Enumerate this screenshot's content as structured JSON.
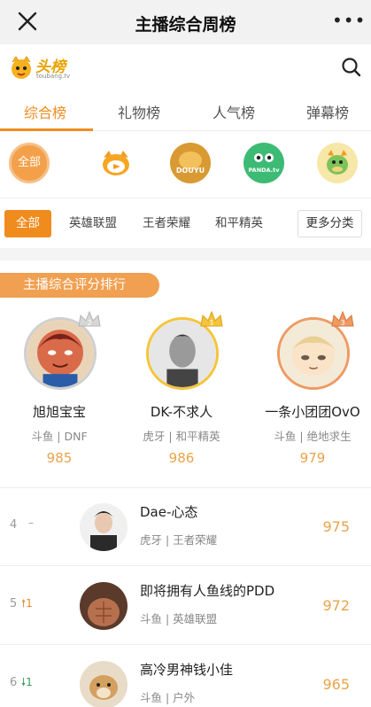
{
  "header": {
    "title": "主播综合周榜",
    "close_icon": "close-icon",
    "more_label": "•••"
  },
  "brand": {
    "name": "头榜",
    "sub": "toubang.tv"
  },
  "tabs": [
    {
      "label": "综合榜",
      "active": true
    },
    {
      "label": "礼物榜"
    },
    {
      "label": "人气榜"
    },
    {
      "label": "弹幕榜"
    }
  ],
  "platforms": [
    {
      "label": "全部",
      "active": true
    },
    {
      "label": "",
      "icon": "huya-logo-icon"
    },
    {
      "label": "DOUYU",
      "icon": "douyu-logo-icon"
    },
    {
      "label": "PANDA.tv",
      "icon": "panda-logo-icon"
    },
    {
      "label": "",
      "icon": "dragon-logo-icon"
    }
  ],
  "categories": [
    {
      "label": "全部",
      "active": true
    },
    {
      "label": "英雄联盟"
    },
    {
      "label": "王者荣耀"
    },
    {
      "label": "和平精英"
    }
  ],
  "more_categories": "更多分类",
  "ranking_title": "主播综合评分排行",
  "top3": [
    {
      "name": "旭旭宝宝",
      "platform": "斗鱼 | DNF",
      "score": "985",
      "medal": "silver"
    },
    {
      "name": "DK-不求人",
      "platform": "虎牙 | 和平精英",
      "score": "986",
      "medal": "gold"
    },
    {
      "name": "一条小团团OvO",
      "platform": "斗鱼 | 绝地求生",
      "score": "979",
      "medal": "bronze"
    }
  ],
  "list": [
    {
      "rank": "4",
      "trend": "–",
      "trend_type": "same",
      "name": "Dae-心态",
      "platform": "虎牙 | 王者荣耀",
      "score": "975"
    },
    {
      "rank": "5",
      "trend": "🠕1",
      "trend_type": "up",
      "name": "即将拥有人鱼线的PDD",
      "platform": "斗鱼 | 英雄联盟",
      "score": "972"
    },
    {
      "rank": "6",
      "trend": "🠗1",
      "trend_type": "down",
      "name": "高冷男神钱小佳",
      "platform": "斗鱼 | 户外",
      "score": "965"
    }
  ],
  "colors": {
    "accent": "#f08c1e",
    "score": "#e9a34a",
    "banner": "#f0a050"
  }
}
